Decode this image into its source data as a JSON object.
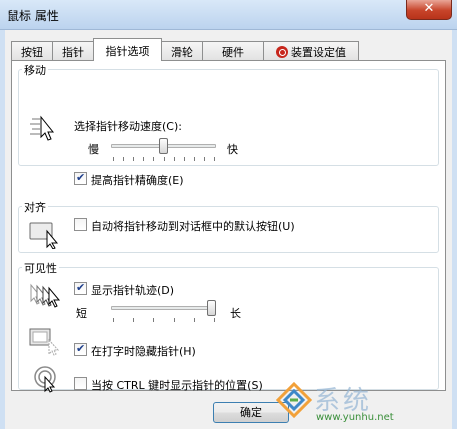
{
  "window": {
    "title": "鼠标 属性",
    "close_label": "✕"
  },
  "tabs": [
    {
      "label": "按钮",
      "active": false
    },
    {
      "label": "指针",
      "active": false
    },
    {
      "label": "指针选项",
      "active": true
    },
    {
      "label": "滑轮",
      "active": false
    },
    {
      "label": "硬件",
      "active": false
    },
    {
      "label": "装置设定值",
      "active": false
    }
  ],
  "motion": {
    "title": "移动",
    "speed_label": "选择指针移动速度(C):",
    "slow": "慢",
    "fast": "快",
    "speed_fraction": 0.5,
    "precision_label": "提高指针精确度(E)",
    "precision_checked": true
  },
  "snap": {
    "title": "对齐",
    "label": "自动将指针移动到对话框中的默认按钮(U)",
    "checked": false
  },
  "visibility": {
    "title": "可见性",
    "trails_label": "显示指针轨迹(D)",
    "trails_checked": true,
    "short": "短",
    "long": "长",
    "trails_fraction": 1.0,
    "hide_label": "在打字时隐藏指针(H)",
    "hide_checked": true,
    "ctrl_label": "当按 CTRL 键时显示指针的位置(S)",
    "ctrl_checked": false
  },
  "buttons": {
    "ok": "确定"
  },
  "watermark": {
    "text": "系统",
    "url": "www.yunhu.net"
  }
}
